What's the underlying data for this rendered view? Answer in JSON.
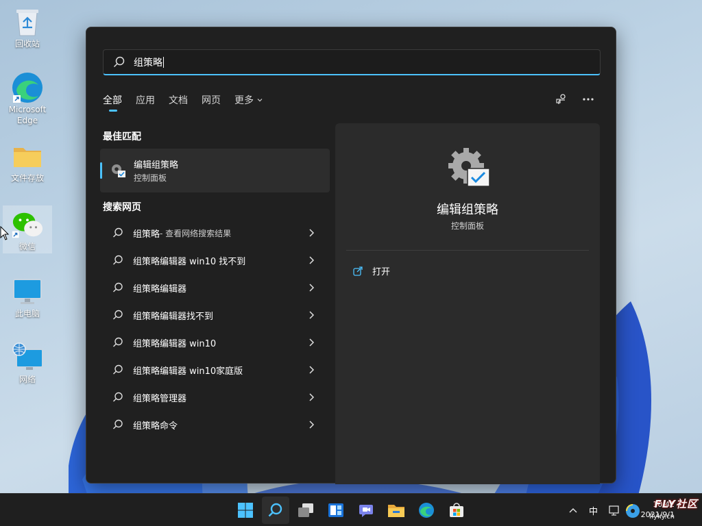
{
  "desktop": {
    "icons": [
      {
        "label": "回收站",
        "icon": "recycle-bin-icon"
      },
      {
        "label": "Microsoft Edge",
        "icon": "edge-icon"
      },
      {
        "label": "文件存放",
        "icon": "folder-icon"
      },
      {
        "label": "微信",
        "icon": "wechat-icon"
      },
      {
        "label": "此电脑",
        "icon": "this-pc-icon"
      },
      {
        "label": "网络",
        "icon": "network-icon"
      }
    ]
  },
  "search": {
    "query": "组策略",
    "tabs": [
      {
        "label": "全部",
        "active": true
      },
      {
        "label": "应用"
      },
      {
        "label": "文档"
      },
      {
        "label": "网页"
      },
      {
        "label": "更多"
      }
    ],
    "best_match_title": "最佳匹配",
    "best_match": {
      "name": "编辑组策略",
      "subtitle": "控制面板",
      "icon": "group-policy-icon"
    },
    "web_section_title": "搜索网页",
    "web_results": [
      {
        "text": "组策略",
        "suffix": " - 查看网络搜索结果"
      },
      {
        "text": "组策略编辑器 win10 找不到"
      },
      {
        "text": "组策略编辑器"
      },
      {
        "text": "组策略编辑器找不到"
      },
      {
        "text": "组策略编辑器 win10"
      },
      {
        "text": "组策略编辑器 win10家庭版"
      },
      {
        "text": "组策略管理器"
      },
      {
        "text": "组策略命令"
      }
    ],
    "detail": {
      "title": "编辑组策略",
      "subtitle": "控制面板",
      "action_open": "打开"
    }
  },
  "taskbar": {
    "apps": [
      "start-icon",
      "search-icon",
      "task-view-icon",
      "widgets-icon",
      "teams-chat-icon",
      "file-explorer-icon",
      "edge-icon",
      "store-icon"
    ],
    "tray": {
      "ime": "中",
      "time": "10:42",
      "date": "2021/9/1"
    },
    "watermark": "FLY社区",
    "watermark_sub": "flyky.cn"
  },
  "colors": {
    "accent": "#4cc2ff",
    "panel_bg": "#202020",
    "detail_bg": "#2b2b2b"
  }
}
